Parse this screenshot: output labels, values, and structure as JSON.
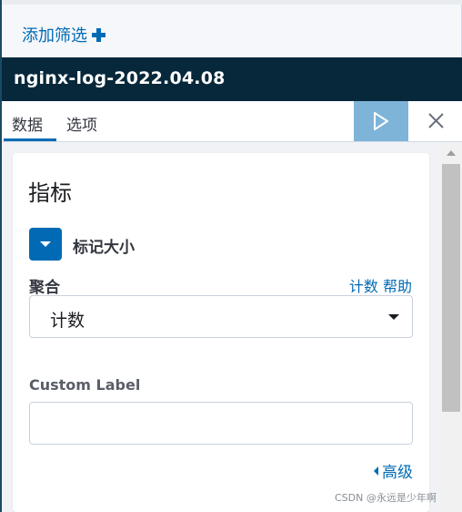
{
  "filter_bar": {
    "add_filter_label": "添加筛选"
  },
  "index_header": {
    "title": "nginx-log-2022.04.08"
  },
  "tabs": {
    "data_label": "数据",
    "options_label": "选项",
    "active": "数据"
  },
  "editor": {
    "section_title": "指标",
    "metric_label": "标记大小",
    "aggregation_label": "聚合",
    "aggregation_help": "计数 帮助",
    "aggregation_value": "计数",
    "custom_label_title": "Custom Label",
    "custom_label_value": "",
    "advanced_label": "高级"
  },
  "watermark": "CSDN @永远是少年啊",
  "colors": {
    "accent": "#006bb4",
    "header_bg": "#07283b",
    "apply_button_bg": "#7fb4d9"
  }
}
